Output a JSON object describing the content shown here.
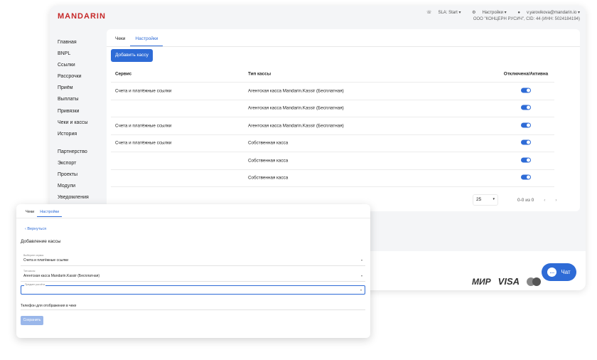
{
  "header": {
    "brand": "MANDARIN",
    "sla": "SLA: Start",
    "settings": "Настройки",
    "user_email": "v.yarovikova@mandarin.io",
    "org_info": "ООО \"КОНЦЕРН РУСИЧ\", CID: 44 (ИНН: 5024184194)"
  },
  "sidebar": {
    "items": [
      {
        "label": "Главная"
      },
      {
        "label": "BNPL"
      },
      {
        "label": "Ссылки"
      },
      {
        "label": "Рассрочки"
      },
      {
        "label": "Приём"
      },
      {
        "label": "Выплаты"
      },
      {
        "label": "Привязки"
      },
      {
        "label": "Чеки и кассы"
      },
      {
        "label": "История"
      }
    ],
    "items2": [
      {
        "label": "Партнерство"
      },
      {
        "label": "Экспорт"
      },
      {
        "label": "Проекты"
      },
      {
        "label": "Модули"
      },
      {
        "label": "Уведомления"
      }
    ]
  },
  "main": {
    "tabs": [
      {
        "label": "Чеки"
      },
      {
        "label": "Настройки"
      }
    ],
    "add_button": "Добавить кассу",
    "columns": [
      "Сервис",
      "Тип кассы",
      "Отключена/Активна"
    ],
    "rows": [
      {
        "service": "Счета и платёжные ссылки",
        "type": "Агентская касса Mandarin.Kassir (Бесплатная)",
        "active": true
      },
      {
        "service": "",
        "type": "Агентская касса Mandarin.Kassir (Бесплатная)",
        "active": true
      },
      {
        "service": "Счета и платёжные ссылки",
        "type": "Агентская касса Mandarin.Kassir (Бесплатная)",
        "active": true
      },
      {
        "service": "Счета и платёжные ссылки",
        "type": "Собственная касса",
        "active": true
      },
      {
        "service": "",
        "type": "Собственная касса",
        "active": true
      },
      {
        "service": "",
        "type": "Собственная касса",
        "active": true
      }
    ],
    "page_size": "25",
    "page_count": "0-0 из 0"
  },
  "footer": {
    "mir": "МИР",
    "visa": "VISA",
    "chat": "Чат"
  },
  "modal": {
    "tabs": [
      {
        "label": "Чеки"
      },
      {
        "label": "Настройки"
      }
    ],
    "back": "Вернуться",
    "title": "Добавление кассы",
    "field1_label": "Выберите сервис",
    "field1_value": "Счета и платёжные ссылки",
    "field2_label": "Тип кассы",
    "field2_value": "Агентская касса Mandarin.Kassir (Бесплатная)",
    "field3_label": "Предмет расчёта",
    "field3_value": "",
    "phone_label": "Телефон для отображения в чеке",
    "save": "Сохранить"
  },
  "colors": {
    "accent": "#2e6bd6",
    "brand": "#c62828"
  }
}
